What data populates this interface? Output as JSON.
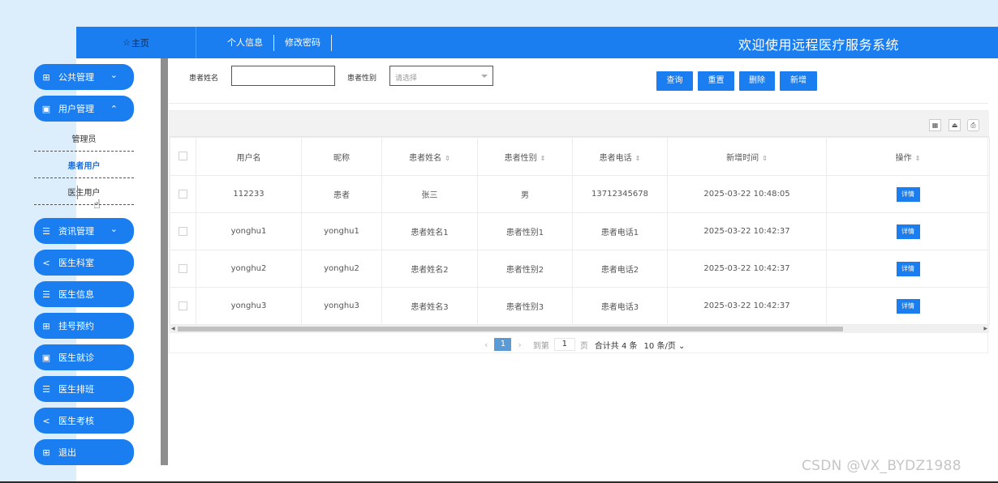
{
  "topbar": {
    "home_icon": "☆",
    "home_label": "主页",
    "nav": [
      "个人信息",
      "修改密码"
    ],
    "title": "欢迎使用远程医疗服务系统"
  },
  "sidebar": {
    "menus": [
      {
        "label": "公共管理",
        "icon": "grid-icon",
        "glyph": "⊞",
        "chevron": "⌄"
      },
      {
        "label": "用户管理",
        "icon": "document-icon",
        "glyph": "▣",
        "chevron": "⌃"
      },
      {
        "label": "资讯管理",
        "icon": "list-icon",
        "glyph": "☰",
        "chevron": "⌄"
      },
      {
        "label": "医生科室",
        "icon": "share-icon",
        "glyph": "<"
      },
      {
        "label": "医生信息",
        "icon": "list-icon",
        "glyph": "☰"
      },
      {
        "label": "挂号预约",
        "icon": "grid-icon",
        "glyph": "⊞"
      },
      {
        "label": "医生就诊",
        "icon": "document-icon",
        "glyph": "▣"
      },
      {
        "label": "医生排班",
        "icon": "list-icon",
        "glyph": "☰"
      },
      {
        "label": "医生考核",
        "icon": "share-icon",
        "glyph": "<"
      },
      {
        "label": "退出",
        "icon": "grid-icon",
        "glyph": "⊞"
      }
    ],
    "submenu": [
      "管理员",
      "患者用户",
      "医生用户"
    ],
    "active_sub": "患者用户"
  },
  "search": {
    "name_label": "患者姓名",
    "name_value": "",
    "gender_label": "患者性别",
    "gender_placeholder": "请选择",
    "buttons": [
      "查询",
      "重置",
      "删除",
      "新增"
    ]
  },
  "table": {
    "columns": [
      "用户名",
      "昵称",
      "患者姓名",
      "患者性别",
      "患者电话",
      "新增时间",
      "操作"
    ],
    "sort_glyph": "⇕",
    "rows": [
      {
        "username": "112233",
        "nickname": "患者",
        "name": "张三",
        "gender": "男",
        "phone": "13712345678",
        "time": "2025-03-22 10:48:05",
        "action": "详情"
      },
      {
        "username": "yonghu1",
        "nickname": "yonghu1",
        "name": "患者姓名1",
        "gender": "患者性别1",
        "phone": "患者电话1",
        "time": "2025-03-22 10:42:37",
        "action": "详情"
      },
      {
        "username": "yonghu2",
        "nickname": "yonghu2",
        "name": "患者姓名2",
        "gender": "患者性别2",
        "phone": "患者电话2",
        "time": "2025-03-22 10:42:37",
        "action": "详情"
      },
      {
        "username": "yonghu3",
        "nickname": "yonghu3",
        "name": "患者姓名3",
        "gender": "患者性别3",
        "phone": "患者电话3",
        "time": "2025-03-22 10:42:37",
        "action": "详情"
      }
    ]
  },
  "pager": {
    "prev": "‹",
    "current": "1",
    "next": "›",
    "goto_label": "到第",
    "goto_value": "1",
    "page_label": "页",
    "total": "合计共 4 条",
    "page_size": "10 条/页 ⌄"
  },
  "watermark": "CSDN @VX_BYDZ1988",
  "colors": {
    "accent": "#1a7ef0",
    "background_tint": "#dcedfb"
  }
}
